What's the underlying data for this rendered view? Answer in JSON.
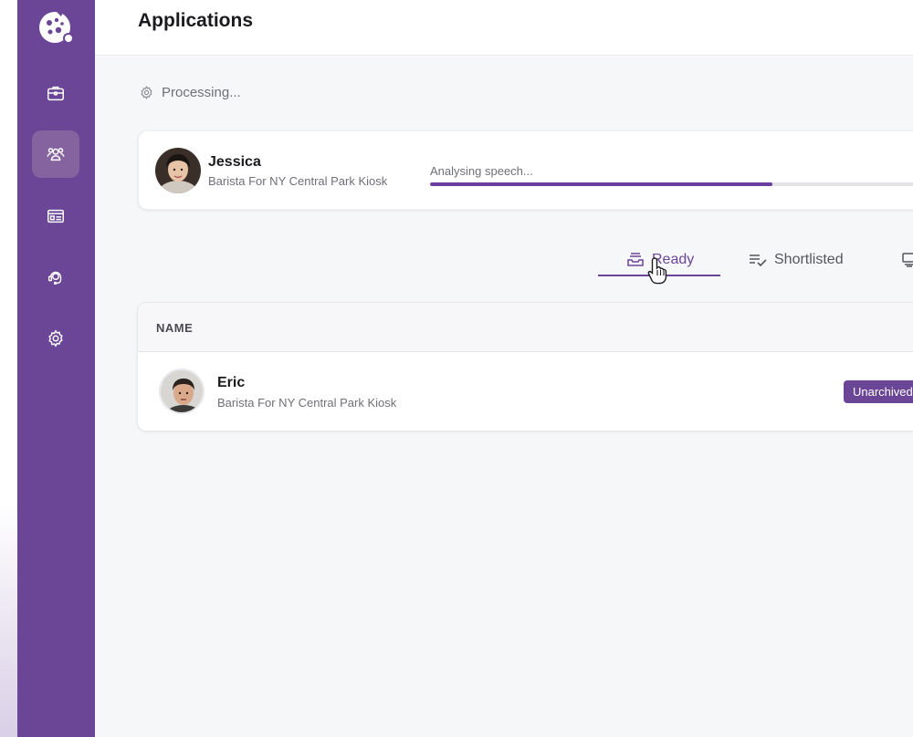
{
  "sidebar": {
    "logo_icon": "cookie-logo-icon",
    "items": [
      {
        "icon": "briefcase-icon",
        "active": false
      },
      {
        "icon": "users-icon",
        "active": true
      },
      {
        "icon": "id-card-icon",
        "active": false
      },
      {
        "icon": "support-agent-icon",
        "active": false
      },
      {
        "icon": "gear-icon",
        "active": false
      }
    ],
    "color": "#6b4596"
  },
  "header": {
    "title": "Applications"
  },
  "processing": {
    "label": "Processing...",
    "icon": "gear-icon",
    "candidate": {
      "name": "Jessica",
      "role": "Barista For NY Central Park Kiosk",
      "progress_label": "Analysing speech...",
      "progress": 0.67
    }
  },
  "tabs": [
    {
      "label": "Ready",
      "icon": "tray-icon",
      "active": true
    },
    {
      "label": "Shortlisted",
      "icon": "list-check-icon",
      "active": false
    },
    {
      "label": "",
      "icon": "archive-icon",
      "active": false
    }
  ],
  "table": {
    "columns": [
      "NAME"
    ],
    "rows": [
      {
        "name": "Eric",
        "role": "Barista For NY Central Park Kiosk",
        "badge": "Unarchived"
      }
    ]
  },
  "colors": {
    "accent": "#6b4596",
    "progress": "#6b3fa0"
  }
}
